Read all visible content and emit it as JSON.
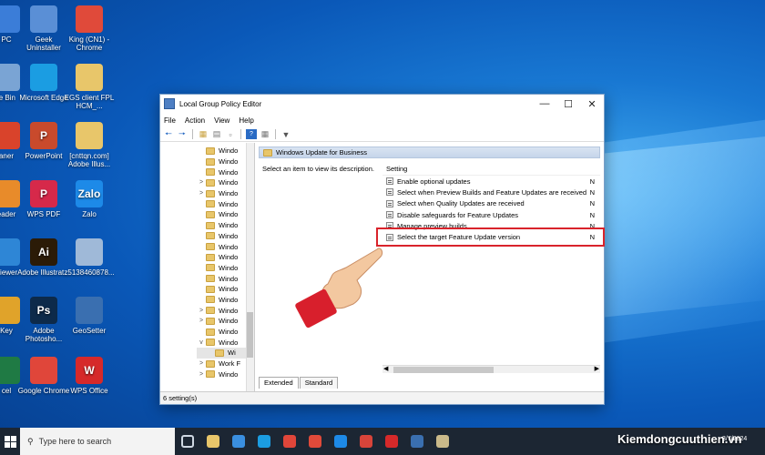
{
  "desktop_icons": [
    {
      "label": "PC",
      "name": "this-pc-icon",
      "color": "#3b7dd8"
    },
    {
      "label": "Geek Uninstaller",
      "name": "geek-uninstaller-icon",
      "color": "#5a8fd6"
    },
    {
      "label": "King (CN1) - Chrome",
      "name": "chrome-profile-icon",
      "color": "#e04a3a"
    },
    {
      "label": "le Bin",
      "name": "recycle-bin-icon",
      "color": "#7aa4d4"
    },
    {
      "label": "Microsoft Edge",
      "name": "edge-icon",
      "color": "#1b9de2"
    },
    {
      "label": "EGS client FPL HCM_...",
      "name": "folder-icon",
      "color": "#e8c66a"
    },
    {
      "label": "aner",
      "name": "cleaner-icon",
      "color": "#d9432b"
    },
    {
      "label": "PowerPoint",
      "name": "powerpoint-icon",
      "color": "#c94a2c"
    },
    {
      "label": "[cnttqn.com] Adobe Illus...",
      "name": "folder-icon",
      "color": "#e8c66a"
    },
    {
      "label": "eader",
      "name": "reader-icon",
      "color": "#e88b2a"
    },
    {
      "label": "WPS PDF",
      "name": "wps-pdf-icon",
      "color": "#d6294a"
    },
    {
      "label": "Zalo",
      "name": "zalo-icon",
      "color": "#1d8ae8"
    },
    {
      "label": "Viewer",
      "name": "viewer-icon",
      "color": "#2e86d6"
    },
    {
      "label": "Adobe Illustrat...",
      "name": "illustrator-icon",
      "color": "#2b1b07"
    },
    {
      "label": "z5138460878...",
      "name": "image-file-icon",
      "color": "#9fb9d8"
    },
    {
      "label": "Key",
      "name": "key-icon",
      "color": "#e0a32a"
    },
    {
      "label": "Adobe Photosho...",
      "name": "photoshop-icon",
      "color": "#0d2a4a"
    },
    {
      "label": "GeoSetter",
      "name": "geosetter-icon",
      "color": "#3a6fb0"
    },
    {
      "label": "cel",
      "name": "excel-icon",
      "color": "#1f7a44"
    },
    {
      "label": "Google Chrome",
      "name": "google-chrome-icon",
      "color": "#e0463a"
    },
    {
      "label": "WPS Office",
      "name": "wps-office-icon",
      "color": "#d6292a"
    }
  ],
  "icon_texts": [
    "",
    "",
    "",
    "",
    "",
    "",
    "",
    "P",
    "",
    "",
    "P",
    "Zalo",
    "",
    "Ai",
    "",
    "",
    "Ps",
    "",
    "",
    "",
    "W"
  ],
  "window": {
    "title": "Local Group Policy Editor",
    "menu": [
      "File",
      "Action",
      "View",
      "Help"
    ],
    "tree_items": [
      {
        "label": "Windo",
        "expander": ""
      },
      {
        "label": "Windo",
        "expander": ""
      },
      {
        "label": "Windo",
        "expander": ""
      },
      {
        "label": "Windo",
        "expander": ">"
      },
      {
        "label": "Windo",
        "expander": ">"
      },
      {
        "label": "Windo",
        "expander": ""
      },
      {
        "label": "Windo",
        "expander": ""
      },
      {
        "label": "Windo",
        "expander": ""
      },
      {
        "label": "Windo",
        "expander": ""
      },
      {
        "label": "Windo",
        "expander": ""
      },
      {
        "label": "Windo",
        "expander": ""
      },
      {
        "label": "Windo",
        "expander": ""
      },
      {
        "label": "Windo",
        "expander": ""
      },
      {
        "label": "Windo",
        "expander": ""
      },
      {
        "label": "Windo",
        "expander": ""
      },
      {
        "label": "Windo",
        "expander": ">"
      },
      {
        "label": "Windo",
        "expander": ">"
      },
      {
        "label": "Windo",
        "expander": ""
      },
      {
        "label": "Windo",
        "expander": "v"
      },
      {
        "label": "Wi",
        "expander": ""
      },
      {
        "label": "Work F",
        "expander": ">"
      },
      {
        "label": "Windo",
        "expander": ">"
      }
    ],
    "pane_header": "Windows Update for Business",
    "description": "Select an item to view its description.",
    "column_setting": "Setting",
    "settings": [
      {
        "label": "Enable optional updates",
        "state": "N"
      },
      {
        "label": "Select when Preview Builds and Feature Updates are received",
        "state": "N"
      },
      {
        "label": "Select when Quality Updates are received",
        "state": "N"
      },
      {
        "label": "Disable safeguards for Feature Updates",
        "state": "N"
      },
      {
        "label": "Manage preview builds",
        "state": "N"
      },
      {
        "label": "Select the target Feature Update version",
        "state": "N"
      }
    ],
    "tabs": [
      "Extended",
      "Standard"
    ],
    "status": "6 setting(s)"
  },
  "taskbar": {
    "search_placeholder": "Type here to search",
    "apps": [
      {
        "name": "task-view-icon",
        "color": "#cfd8e3"
      },
      {
        "name": "file-explorer-icon",
        "color": "#e8c66a"
      },
      {
        "name": "store-icon",
        "color": "#3a8fe0"
      },
      {
        "name": "edge-taskbar-icon",
        "color": "#1b9de2"
      },
      {
        "name": "chrome-taskbar-icon",
        "color": "#e0463a"
      },
      {
        "name": "chrome-profile-taskbar-icon",
        "color": "#e04a3a"
      },
      {
        "name": "zalo-taskbar-icon",
        "color": "#1d8ae8"
      },
      {
        "name": "chrome-alt-taskbar-icon",
        "color": "#d8443a"
      },
      {
        "name": "wps-taskbar-icon",
        "color": "#d6292a"
      },
      {
        "name": "geosetter-taskbar-icon",
        "color": "#3a6fb0"
      },
      {
        "name": "group-policy-taskbar-icon",
        "color": "#c9b98a"
      }
    ],
    "brand": "Kiemdongcuuthien.vn",
    "clock_time": "",
    "clock_date": "3/7/2024"
  }
}
